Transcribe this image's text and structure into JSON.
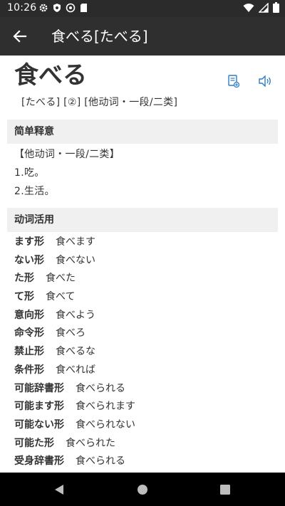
{
  "status_bar": {
    "time": "10:26"
  },
  "app_bar": {
    "title": "食べる[たべる]"
  },
  "entry": {
    "word": "食べる",
    "reading": "[たべる] [②] [他动词・一段/二类]"
  },
  "sections": {
    "simple_meaning": {
      "heading": "简单释意",
      "definitions": [
        "【他动词・一段/二类】",
        "1.吃。",
        "2.生活。"
      ]
    },
    "conjugation": {
      "heading": "动词活用",
      "rows": [
        {
          "label": "ます形",
          "value": "食べます"
        },
        {
          "label": "ない形",
          "value": "食べない"
        },
        {
          "label": "た形",
          "value": "食べた"
        },
        {
          "label": "て形",
          "value": "食べて"
        },
        {
          "label": "意向形",
          "value": "食べよう"
        },
        {
          "label": "命令形",
          "value": "食べろ"
        },
        {
          "label": "禁止形",
          "value": "食べるな"
        },
        {
          "label": "条件形",
          "value": "食べれば"
        },
        {
          "label": "可能辞書形",
          "value": "食べられる"
        },
        {
          "label": "可能ます形",
          "value": "食べられます"
        },
        {
          "label": "可能ない形",
          "value": "食べられない"
        },
        {
          "label": "可能た形",
          "value": "食べられた"
        },
        {
          "label": "受身辞書形",
          "value": "食べられる"
        }
      ]
    }
  },
  "icons": {
    "back": "arrow-back-icon",
    "notebook": "add-to-notebook-icon",
    "speaker": "speaker-icon"
  },
  "colors": {
    "accent": "#2f7cc8",
    "app_bar": "#2f2f2f",
    "section_bg": "#f0f0f0"
  }
}
